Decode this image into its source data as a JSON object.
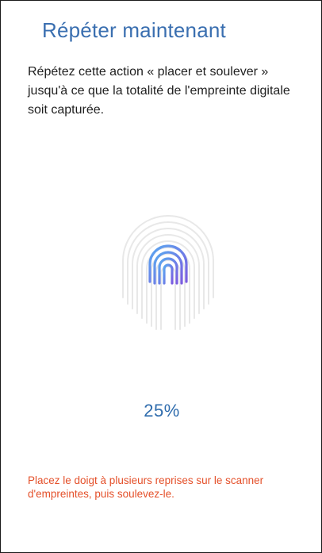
{
  "header": {
    "title": "Répéter maintenant"
  },
  "body": {
    "description": "Répétez cette action « placer et soulever » jusqu'à ce que la totalité de l'empreinte digitale soit capturée."
  },
  "sensor": {
    "icon": "fingerprint-icon",
    "progress": 0.25,
    "colors": {
      "accent_start": "#5aa9f0",
      "accent_end": "#7b5ce0",
      "ghost": "#e6e6e6"
    }
  },
  "progress": {
    "label": "25%"
  },
  "footer": {
    "instruction": "Placez le doigt à plusieurs reprises sur le scanner d'empreintes, puis soulevez-le."
  }
}
